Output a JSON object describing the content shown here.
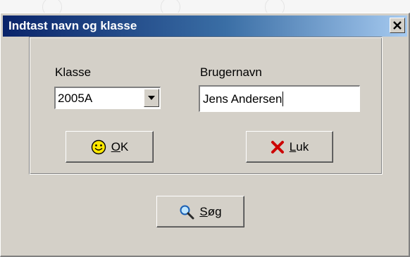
{
  "window": {
    "title": "Indtast navn og klasse"
  },
  "form": {
    "class_label": "Klasse",
    "class_value": "2005A",
    "username_label": "Brugernavn",
    "username_value": "Jens Andersen"
  },
  "buttons": {
    "ok": {
      "mnemonic": "O",
      "rest": "K",
      "icon": "smiley-icon"
    },
    "close": {
      "mnemonic": "L",
      "rest": "uk",
      "icon": "red-x-icon"
    },
    "search": {
      "mnemonic": "S",
      "rest": "øg",
      "icon": "magnifier-icon"
    }
  },
  "colors": {
    "title_gradient_start": "#0a246a",
    "title_gradient_end": "#a6caf0",
    "dialog_face": "#d4d0c8"
  }
}
